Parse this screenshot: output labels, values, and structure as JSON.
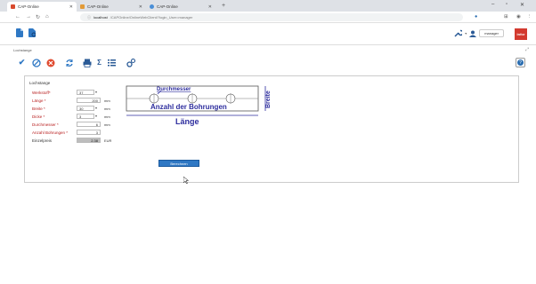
{
  "browser": {
    "tabs": [
      {
        "title": "CAP-Online",
        "active": true,
        "favicon_color": "#d84a2e"
      },
      {
        "title": "CAP-Online",
        "active": false,
        "favicon_color": "#e29a36"
      },
      {
        "title": "CAP-Online",
        "active": false,
        "favicon_color": "#4a8fd8"
      }
    ],
    "url_host": "localhost",
    "url_path": "/CAPOnline/OnlineWebClient/?login_User=manager"
  },
  "app": {
    "user": "manager",
    "brand": "infor",
    "breadcrumb": "Lochstange"
  },
  "form": {
    "legend": "Lochstange",
    "fields": [
      {
        "label": "Werkstoff*",
        "value": "37",
        "unit": "",
        "required": true
      },
      {
        "label": "Länge *",
        "value": "200",
        "unit": "mm",
        "required": true
      },
      {
        "label": "Breite *",
        "value": "30",
        "unit": "mm",
        "required": true
      },
      {
        "label": "Dicke *",
        "value": "3",
        "unit": "mm",
        "required": true
      },
      {
        "label": "Durchmesser *",
        "value": "6",
        "unit": "mm",
        "required": true
      },
      {
        "label": "Anzahl Bohrungen *",
        "value": "3",
        "unit": "",
        "required": true
      },
      {
        "label": "Einzelpreis",
        "value": "2.38",
        "unit": "EUR",
        "required": false
      }
    ],
    "calculate_button": "Berechnen"
  },
  "diagram": {
    "diameter_label": "Durchmesser",
    "holes_label": "Anzahl der Bohrungen",
    "width_label": "Breite",
    "length_label": "Länge"
  },
  "colors": {
    "accent_blue": "#2f78c4",
    "required_red": "#b71c1c",
    "diagram_text": "#2d2d9e"
  }
}
